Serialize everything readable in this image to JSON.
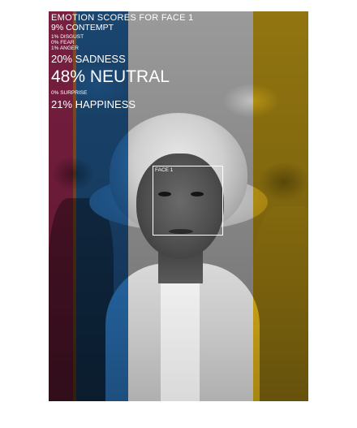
{
  "title": "EMOTION SCORES FOR FACE 1",
  "emotions": [
    {
      "label": "9% CONTEMPT",
      "value": 9,
      "size": "med"
    },
    {
      "label": "1% DISGUST",
      "value": 1,
      "size": "small"
    },
    {
      "label": "0% FEAR",
      "value": 0,
      "size": "small"
    },
    {
      "label": "1% ANGER",
      "value": 1,
      "size": "small"
    },
    {
      "label": "20% SADNESS",
      "value": 20,
      "size": "large"
    },
    {
      "label": "48% NEUTRAL",
      "value": 48,
      "size": "xl"
    },
    {
      "label": "0% SURPRISE",
      "value": 0,
      "size": "small"
    },
    {
      "label": "21% HAPPINESS",
      "value": 21,
      "size": "large"
    }
  ],
  "face_label": "FACE 1",
  "stripe_colors": {
    "magenta": "#c8326a",
    "orange": "#d9793a",
    "blue": "#2a72b8",
    "gray": "#ffffff",
    "yellow": "#f2c21a"
  }
}
